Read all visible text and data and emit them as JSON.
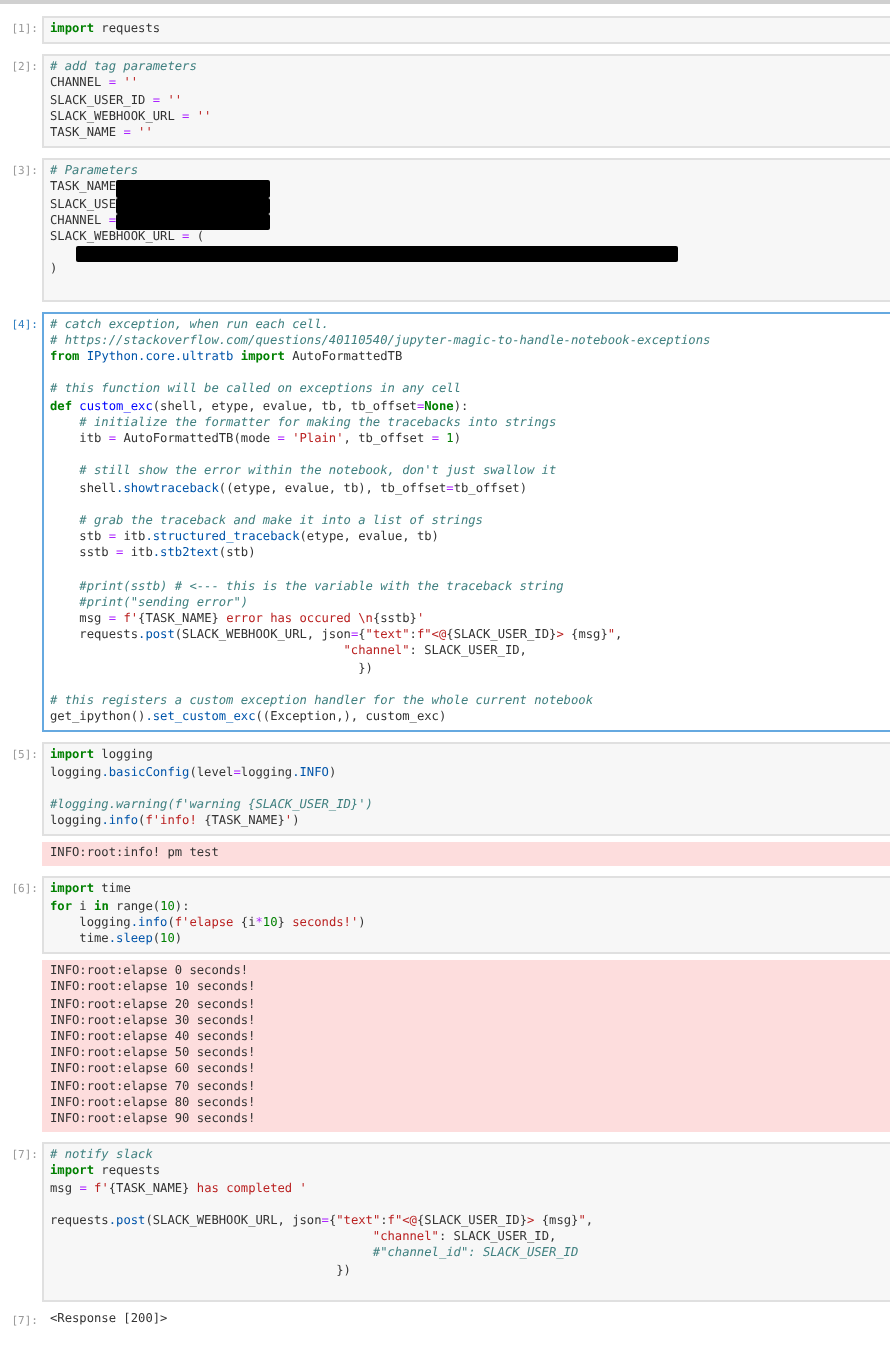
{
  "cells": [
    {
      "prompt": "[1]:",
      "selected": false,
      "lines": [
        {
          "segments": [
            {
              "kind": "keyword",
              "text": "import"
            },
            " requests"
          ]
        }
      ]
    },
    {
      "prompt": "[2]:",
      "selected": false,
      "lines": [
        {
          "segments": [
            {
              "kind": "comment",
              "text": "# add tag parameters"
            }
          ]
        },
        {
          "segments": [
            "CHANNEL ",
            {
              "kind": "operator",
              "text": "="
            },
            {
              "kind": "string",
              "text": " ''"
            }
          ]
        },
        {
          "segments": [
            "SLACK_USER_ID ",
            {
              "kind": "operator",
              "text": "="
            },
            {
              "kind": "string",
              "text": " ''"
            }
          ]
        },
        {
          "segments": [
            "SLACK_WEBHOOK_URL ",
            {
              "kind": "operator",
              "text": "="
            },
            {
              "kind": "string",
              "text": " ''"
            }
          ]
        },
        {
          "segments": [
            "TASK_NAME ",
            {
              "kind": "operator",
              "text": "="
            },
            {
              "kind": "string",
              "text": " ''"
            }
          ]
        }
      ]
    },
    {
      "prompt": "[3]:",
      "selected": false,
      "trailing_gap": true,
      "lines": [
        {
          "segments": [
            {
              "kind": "comment",
              "text": "# Parameters"
            }
          ]
        },
        {
          "segments": [
            "TASK_NAME",
            {
              "kind": "redacted",
              "wide": false
            }
          ]
        },
        {
          "segments": [
            "SLACK_USE",
            {
              "kind": "redacted",
              "wide": false
            }
          ]
        },
        {
          "segments": [
            "CHANNEL ",
            {
              "kind": "operator",
              "text": "="
            },
            {
              "kind": "redacted",
              "wide": false
            }
          ]
        },
        {
          "segments": [
            "SLACK_WEBHOOK_URL ",
            {
              "kind": "operator",
              "text": "="
            },
            " ("
          ]
        },
        {
          "segments": [
            {
              "kind": "redacted",
              "wide": true
            }
          ]
        },
        {
          "segments": [
            ")"
          ]
        }
      ]
    },
    {
      "prompt": "[4]:",
      "selected": true,
      "lines": [
        {
          "segments": [
            {
              "kind": "comment",
              "text": "# catch exception, when run each cell."
            }
          ]
        },
        {
          "segments": [
            {
              "kind": "comment",
              "text": "# https://stackoverflow.com/questions/40110540/jupyter-magic-to-handle-notebook-exceptions"
            }
          ]
        },
        {
          "segments": [
            {
              "kind": "keyword",
              "text": "from"
            },
            {
              "kind": "attribute",
              "text": " IPython.core.ultratb"
            },
            {
              "kind": "keyword",
              "text": " import"
            },
            " AutoFormattedTB"
          ]
        },
        {
          "gap_before": true,
          "segments": [
            {
              "kind": "comment",
              "text": "# this function will be called on exceptions in any cell"
            }
          ]
        },
        {
          "segments": [
            {
              "kind": "keyword",
              "text": "def"
            },
            {
              "kind": "function",
              "text": " custom_exc"
            },
            "(shell, etype, evalue, tb, tb_offset",
            {
              "kind": "operator",
              "text": "="
            },
            {
              "kind": "keyword",
              "text": "None"
            },
            "):"
          ]
        },
        {
          "segments": [
            {
              "kind": "comment",
              "text": "    # initialize the formatter for making the tracebacks into strings"
            }
          ]
        },
        {
          "segments": [
            "    itb ",
            {
              "kind": "operator",
              "text": "="
            },
            " AutoFormattedTB(mode ",
            {
              "kind": "operator",
              "text": "="
            },
            {
              "kind": "string",
              "text": " 'Plain'"
            },
            ", tb_offset ",
            {
              "kind": "operator",
              "text": "="
            },
            {
              "kind": "number",
              "text": " 1"
            },
            ")"
          ]
        },
        {
          "gap_before": true,
          "segments": [
            {
              "kind": "comment",
              "text": "    # still show the error within the notebook, don't just swallow it"
            }
          ]
        },
        {
          "segments": [
            "    shell",
            {
              "kind": "attribute",
              "text": ".showtraceback"
            },
            "((etype, evalue, tb), tb_offset",
            {
              "kind": "operator",
              "text": "="
            },
            "tb_offset)"
          ]
        },
        {
          "gap_before": true,
          "segments": [
            {
              "kind": "comment",
              "text": "    # grab the traceback and make it into a list of strings"
            }
          ]
        },
        {
          "segments": [
            "    stb ",
            {
              "kind": "operator",
              "text": "="
            },
            " itb",
            {
              "kind": "attribute",
              "text": ".structured_traceback"
            },
            "(etype, evalue, tb)"
          ]
        },
        {
          "segments": [
            "    sstb ",
            {
              "kind": "operator",
              "text": "="
            },
            " itb",
            {
              "kind": "attribute",
              "text": ".stb2text"
            },
            "(stb)"
          ]
        },
        {
          "gap_before": true,
          "segments": [
            {
              "kind": "comment",
              "text": "    #print(sstb) # <--- this is the variable with the traceback string"
            }
          ]
        },
        {
          "segments": [
            {
              "kind": "comment",
              "text": "    #print(\"sending error\")"
            }
          ]
        },
        {
          "segments": [
            "    msg ",
            {
              "kind": "operator",
              "text": "="
            },
            {
              "kind": "string",
              "text": " f'"
            },
            "{TASK_NAME}",
            {
              "kind": "string",
              "text": " error has occured \\n"
            },
            "{sstb}",
            {
              "kind": "string",
              "text": "'"
            }
          ]
        },
        {
          "segments": [
            "    requests",
            {
              "kind": "attribute",
              "text": ".post"
            },
            "(SLACK_WEBHOOK_URL, json",
            {
              "kind": "operator",
              "text": "="
            },
            "{",
            {
              "kind": "string",
              "text": "\"text\""
            },
            ":",
            {
              "kind": "string",
              "text": "f\"<@"
            },
            "{SLACK_USER_ID}",
            {
              "kind": "string",
              "text": "> "
            },
            "{msg}",
            {
              "kind": "string",
              "text": "\""
            },
            ","
          ]
        },
        {
          "segments": [
            {
              "kind": "string",
              "text": "                                        \"channel\""
            },
            ": SLACK_USER_ID,"
          ]
        },
        {
          "segments": [
            "                                          })"
          ]
        },
        {
          "gap_before": true,
          "segments": [
            {
              "kind": "comment",
              "text": "# this registers a custom exception handler for the whole current notebook"
            }
          ]
        },
        {
          "segments": [
            "get_ipython()",
            {
              "kind": "attribute",
              "text": ".set_custom_exc"
            },
            "((Exception,), custom_exc)"
          ]
        }
      ]
    },
    {
      "prompt": "[5]:",
      "selected": false,
      "lines": [
        {
          "segments": [
            {
              "kind": "keyword",
              "text": "import"
            },
            " logging"
          ]
        },
        {
          "segments": [
            "logging",
            {
              "kind": "attribute",
              "text": ".basicConfig"
            },
            "(level",
            {
              "kind": "operator",
              "text": "="
            },
            "logging",
            {
              "kind": "attribute",
              "text": ".INFO"
            },
            ")"
          ]
        },
        {
          "gap_before": true,
          "segments": [
            {
              "kind": "comment",
              "text": "#logging.warning(f'warning {SLACK_USER_ID}')"
            }
          ]
        },
        {
          "segments": [
            "logging",
            {
              "kind": "attribute",
              "text": ".info"
            },
            "(",
            {
              "kind": "string",
              "text": "f'info! "
            },
            "{TASK_NAME}",
            {
              "kind": "string",
              "text": "'"
            },
            ")"
          ]
        }
      ],
      "outputs": [
        {
          "kind": "stderr",
          "lines": [
            "INFO:root:info! pm test"
          ]
        }
      ]
    },
    {
      "prompt": "[6]:",
      "selected": false,
      "lines": [
        {
          "segments": [
            {
              "kind": "keyword",
              "text": "import"
            },
            " time"
          ]
        },
        {
          "segments": [
            {
              "kind": "keyword",
              "text": "for"
            },
            " i ",
            {
              "kind": "keyword",
              "text": "in"
            },
            " range(",
            {
              "kind": "number",
              "text": "10"
            },
            "):"
          ]
        },
        {
          "segments": [
            "    logging",
            {
              "kind": "attribute",
              "text": ".info"
            },
            "(",
            {
              "kind": "string",
              "text": "f'elapse "
            },
            "{i",
            {
              "kind": "operator",
              "text": "*"
            },
            {
              "kind": "number",
              "text": "10"
            },
            "}",
            {
              "kind": "string",
              "text": " seconds!'"
            },
            ")"
          ]
        },
        {
          "segments": [
            "    time",
            {
              "kind": "attribute",
              "text": ".sleep"
            },
            "(",
            {
              "kind": "number",
              "text": "10"
            },
            ")"
          ]
        }
      ],
      "outputs": [
        {
          "kind": "stderr",
          "lines": [
            "INFO:root:elapse 0 seconds!",
            "INFO:root:elapse 10 seconds!",
            "INFO:root:elapse 20 seconds!",
            "INFO:root:elapse 30 seconds!",
            "INFO:root:elapse 40 seconds!",
            "INFO:root:elapse 50 seconds!",
            "INFO:root:elapse 60 seconds!",
            "INFO:root:elapse 70 seconds!",
            "INFO:root:elapse 80 seconds!",
            "INFO:root:elapse 90 seconds!"
          ]
        }
      ]
    },
    {
      "prompt": "[7]:",
      "selected": false,
      "trailing_gap": true,
      "lines": [
        {
          "segments": [
            {
              "kind": "comment",
              "text": "# notify slack"
            }
          ]
        },
        {
          "segments": [
            {
              "kind": "keyword",
              "text": "import"
            },
            " requests"
          ]
        },
        {
          "segments": [
            "msg ",
            {
              "kind": "operator",
              "text": "="
            },
            {
              "kind": "string",
              "text": " f'"
            },
            "{TASK_NAME}",
            {
              "kind": "string",
              "text": " has completed '"
            }
          ]
        },
        {
          "gap_before": true,
          "segments": [
            "requests",
            {
              "kind": "attribute",
              "text": ".post"
            },
            "(SLACK_WEBHOOK_URL, json",
            {
              "kind": "operator",
              "text": "="
            },
            "{",
            {
              "kind": "string",
              "text": "\"text\""
            },
            ":",
            {
              "kind": "string",
              "text": "f\"<@"
            },
            "{SLACK_USER_ID}",
            {
              "kind": "string",
              "text": "> "
            },
            "{msg}",
            {
              "kind": "string",
              "text": "\""
            },
            ","
          ]
        },
        {
          "segments": [
            {
              "kind": "string",
              "text": "                                            \"channel\""
            },
            ": SLACK_USER_ID,"
          ]
        },
        {
          "segments": [
            {
              "kind": "comment",
              "text": "                                            #\"channel_id\": SLACK_USER_ID"
            }
          ]
        },
        {
          "segments": [
            "                                       })"
          ]
        }
      ],
      "outputs": [
        {
          "kind": "result",
          "prompt": "[7]:",
          "lines": [
            "<Response [200]>"
          ]
        }
      ]
    }
  ]
}
